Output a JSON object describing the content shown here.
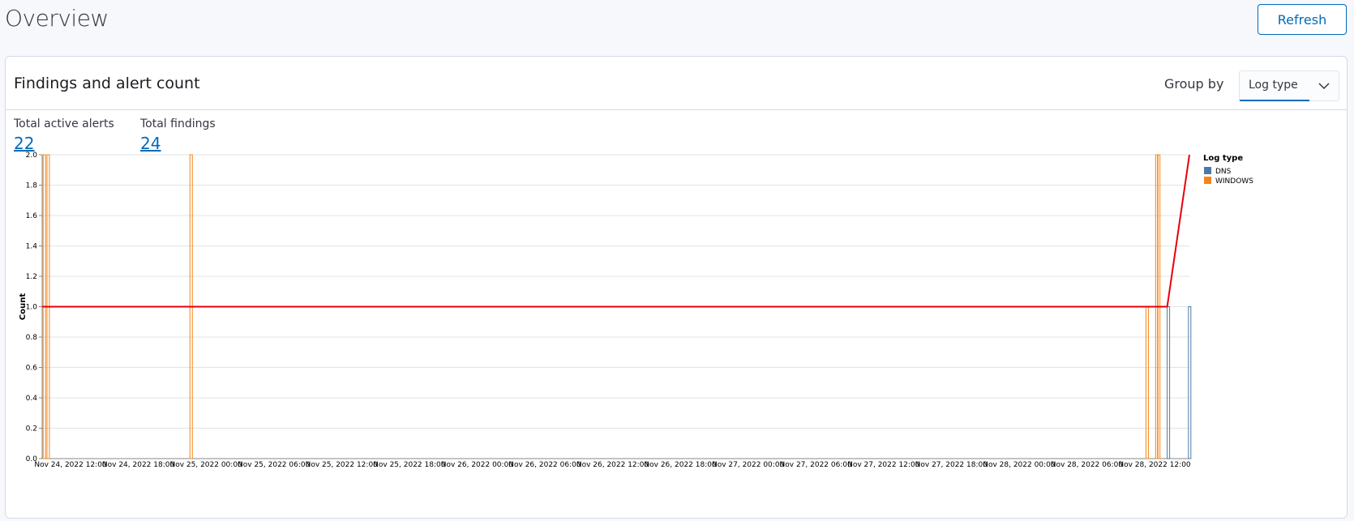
{
  "header": {
    "title": "Overview",
    "refresh_label": "Refresh"
  },
  "panel": {
    "title": "Findings and alert count",
    "group_by_label": "Group by",
    "group_by_value": "Log type",
    "stats": [
      {
        "label": "Total active alerts",
        "value": "22"
      },
      {
        "label": "Total findings",
        "value": "24"
      }
    ]
  },
  "colors": {
    "accent": "#006bb8",
    "dns": "#4c78a8",
    "windows": "#f58518",
    "alerts_line": "#e7000b"
  },
  "chart_data": {
    "type": "bar",
    "ylabel": "Count",
    "xlabel": "",
    "ylim": [
      0,
      2
    ],
    "y_ticks": [
      "0.0",
      "0.2",
      "0.4",
      "0.6",
      "0.8",
      "1.0",
      "1.2",
      "1.4",
      "1.6",
      "1.8",
      "2.0"
    ],
    "x_ticks": [
      "Nov 24, 2022 12:00",
      "Nov 24, 2022 18:00",
      "Nov 25, 2022 00:00",
      "Nov 25, 2022 06:00",
      "Nov 25, 2022 12:00",
      "Nov 25, 2022 18:00",
      "Nov 26, 2022 00:00",
      "Nov 26, 2022 06:00",
      "Nov 26, 2022 12:00",
      "Nov 26, 2022 18:00",
      "Nov 27, 2022 00:00",
      "Nov 27, 2022 06:00",
      "Nov 27, 2022 12:00",
      "Nov 27, 2022 18:00",
      "Nov 28, 2022 00:00",
      "Nov 28, 2022 06:00",
      "Nov 28, 2022 12:00"
    ],
    "xlim": [
      "2022-11-24 11:55",
      "2022-11-28 14:55"
    ],
    "legend_title": "Log type",
    "legend_position": "right",
    "series": [
      {
        "name": "DNS",
        "bars": [
          {
            "x": "2022-11-28 13:00",
            "y": 1
          },
          {
            "x": "2022-11-28 14:50",
            "y": 1
          }
        ]
      },
      {
        "name": "WINDOWS",
        "bars": [
          {
            "x": "2022-11-24 12:00",
            "y": 2
          },
          {
            "x": "2022-11-24 12:20",
            "y": 2
          },
          {
            "x": "2022-11-25 00:40",
            "y": 2
          },
          {
            "x": "2022-11-28 11:10",
            "y": 1
          },
          {
            "x": "2022-11-28 12:00",
            "y": 2
          },
          {
            "x": "2022-11-28 12:10",
            "y": 2
          }
        ]
      }
    ],
    "alert_line": [
      {
        "x": "2022-11-24 11:55",
        "y": 1
      },
      {
        "x": "2022-11-28 13:00",
        "y": 1
      },
      {
        "x": "2022-11-28 14:55",
        "y": 2
      }
    ]
  }
}
